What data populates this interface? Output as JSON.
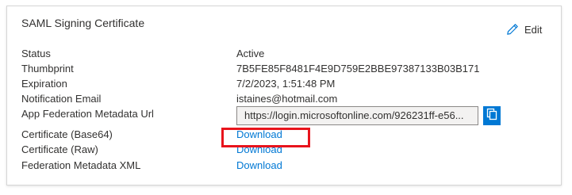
{
  "card": {
    "title": "SAML Signing Certificate",
    "edit_label": "Edit"
  },
  "rows": {
    "status": {
      "label": "Status",
      "value": "Active"
    },
    "thumbprint": {
      "label": "Thumbprint",
      "value": "7B5FE85F8481F4E9D759E2BBE97387133B03B171"
    },
    "expiration": {
      "label": "Expiration",
      "value": "7/2/2023, 1:51:48 PM"
    },
    "notification_email": {
      "label": "Notification Email",
      "value": "istaines@hotmail.com"
    },
    "metadata_url": {
      "label": "App Federation Metadata Url",
      "value": "https://login.microsoftonline.com/926231ff-e56..."
    },
    "cert_base64": {
      "label": "Certificate (Base64)",
      "value": "Download"
    },
    "cert_raw": {
      "label": "Certificate (Raw)",
      "value": "Download"
    },
    "federation_xml": {
      "label": "Federation Metadata XML",
      "value": "Download"
    }
  },
  "icons": {
    "edit": "pencil-icon",
    "copy": "copy-icon"
  },
  "colors": {
    "link": "#0078d4",
    "copy_button": "#0078d4",
    "highlight": "#e8141c"
  }
}
